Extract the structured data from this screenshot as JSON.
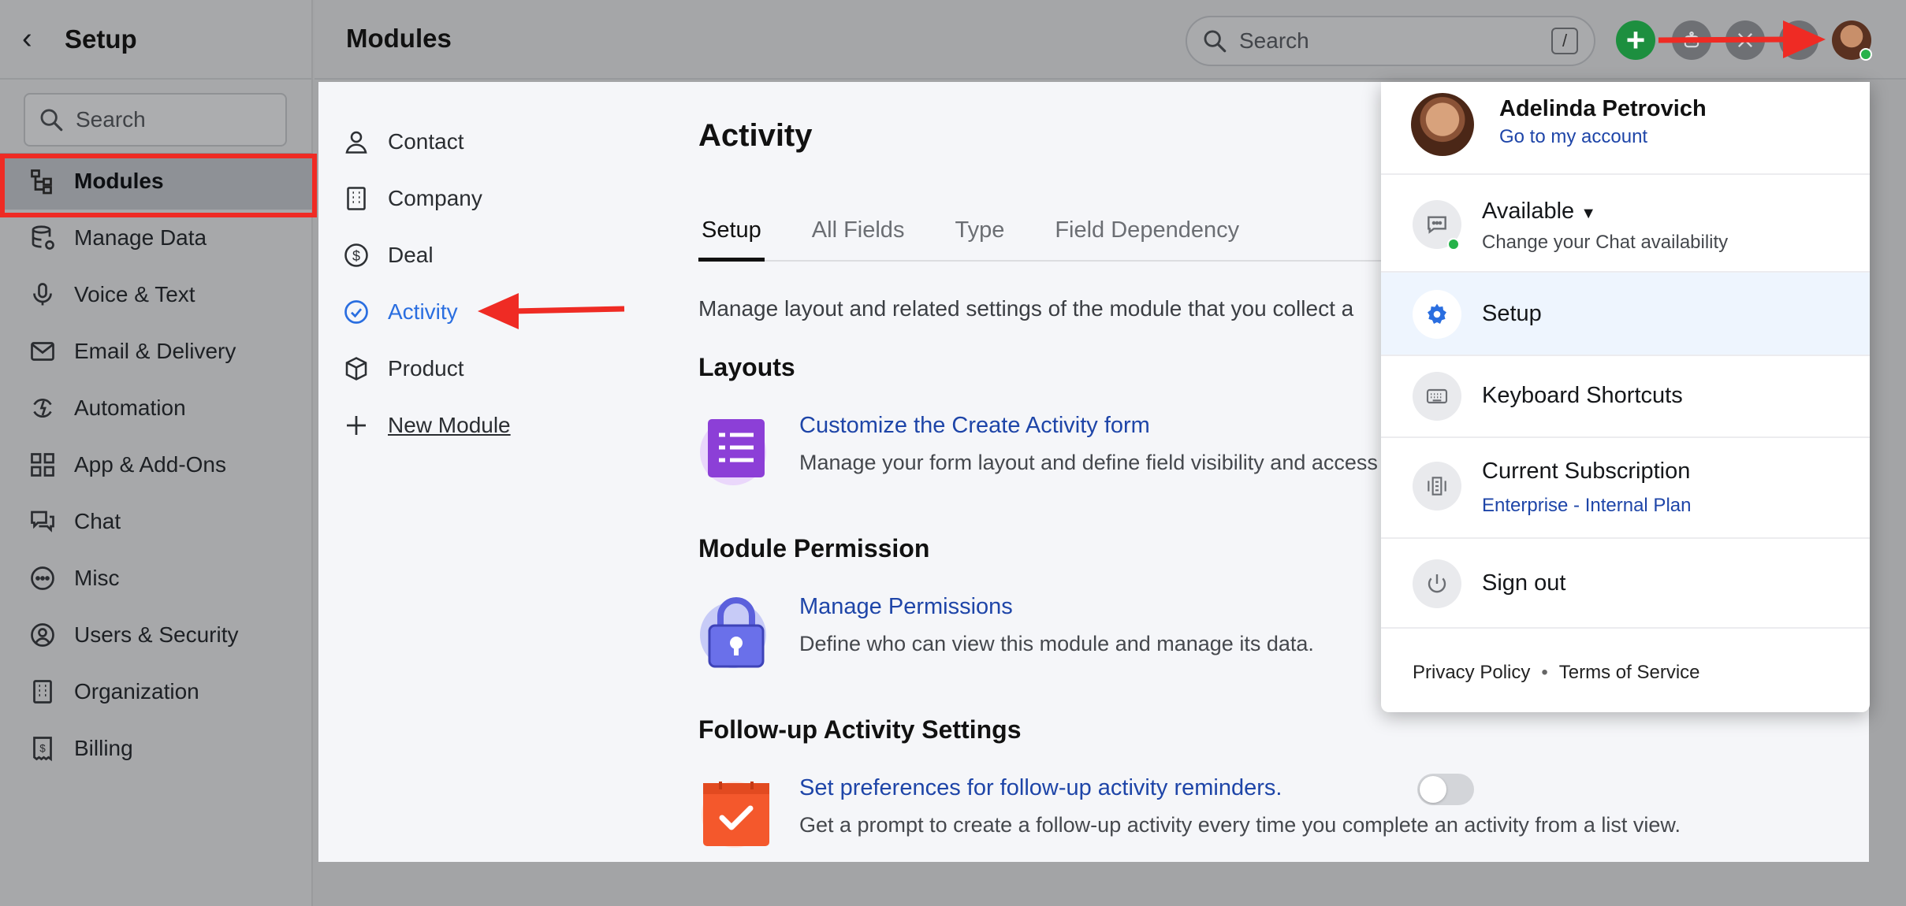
{
  "sidebar": {
    "back_icon": "chevron-left-icon",
    "title": "Setup",
    "search_placeholder": "Search",
    "items": [
      {
        "label": "Modules",
        "icon": "modules-icon",
        "active": true
      },
      {
        "label": "Manage Data",
        "icon": "database-icon"
      },
      {
        "label": "Voice & Text",
        "icon": "microphone-icon"
      },
      {
        "label": "Email & Delivery",
        "icon": "envelope-icon"
      },
      {
        "label": "Automation",
        "icon": "automation-icon"
      },
      {
        "label": "App & Add-Ons",
        "icon": "apps-grid-icon"
      },
      {
        "label": "Chat",
        "icon": "chat-icon"
      },
      {
        "label": "Misc",
        "icon": "more-icon"
      },
      {
        "label": "Users & Security",
        "icon": "user-circle-icon"
      },
      {
        "label": "Organization",
        "icon": "building-icon"
      },
      {
        "label": "Billing",
        "icon": "receipt-icon"
      }
    ]
  },
  "header": {
    "title": "Modules",
    "search_placeholder": "Search",
    "search_shortcut": "/",
    "add_button": "+",
    "accent": "#1d8f3f"
  },
  "modules": {
    "items": [
      {
        "label": "Contact",
        "icon": "person-icon"
      },
      {
        "label": "Company",
        "icon": "building-icon"
      },
      {
        "label": "Deal",
        "icon": "dollar-icon"
      },
      {
        "label": "Activity",
        "icon": "check-circle-icon",
        "active": true
      },
      {
        "label": "Product",
        "icon": "box-icon"
      },
      {
        "label": "New Module",
        "icon": "plus-icon"
      }
    ]
  },
  "content": {
    "title": "Activity",
    "tabs": [
      "Setup",
      "All Fields",
      "Type",
      "Field Dependency"
    ],
    "active_tab": "Setup",
    "description": "Manage layout and related settings of the module that you collect a",
    "sections": {
      "layouts": {
        "title": "Layouts",
        "link": "Customize the Create Activity form",
        "sub": "Manage your form layout and define field visibility and access"
      },
      "permission": {
        "title": "Module Permission",
        "link": "Manage Permissions",
        "sub": "Define who can view this module and manage its data."
      },
      "followup": {
        "title": "Follow-up Activity Settings",
        "link": "Set preferences for follow-up activity reminders.",
        "sub": "Get a prompt to create a follow-up activity every time you complete an activity from a list view.",
        "toggle_on": false
      }
    }
  },
  "profile_menu": {
    "name": "Adelinda Petrovich",
    "account_link": "Go to my account",
    "availability": {
      "label": "Available",
      "sub": "Change your Chat availability",
      "status_color": "#26b24a"
    },
    "setup": "Setup",
    "shortcuts": "Keyboard Shortcuts",
    "subscription": {
      "label": "Current Subscription",
      "plan": "Enterprise - Internal Plan"
    },
    "sign_out": "Sign out",
    "footer": {
      "privacy": "Privacy Policy",
      "separator": "•",
      "terms": "Terms of Service"
    }
  },
  "annotations": {
    "arrow_color": "#ef2b24",
    "highlight_color": "#ef2b24"
  }
}
